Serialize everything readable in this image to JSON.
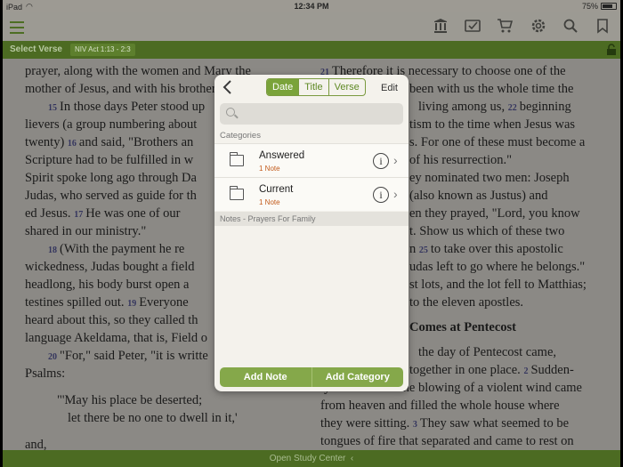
{
  "status_bar": {
    "device": "iPad",
    "time": "12:34 PM",
    "battery": "75%"
  },
  "toolbar": {
    "icons": [
      "menu-icon",
      "library-icon",
      "notes-icon",
      "cart-icon",
      "settings-icon",
      "search-icon",
      "bookmark-icon"
    ]
  },
  "verse_bar": {
    "select_label": "Select Verse",
    "reference": "NIV Act 1:13 - 2:3"
  },
  "scripture": {
    "left_lines": [
      {
        "pre": "prayer,",
        "rest": " along with the women and Mary the"
      },
      {
        "pre": "",
        "rest": "mother of Jesus, and with his brothers."
      },
      {
        "verse": "15",
        "rest": "In those days Peter stood up",
        "indent": true
      },
      {
        "pre": "",
        "rest": "lievers (a group numbering about"
      },
      {
        "pre": "",
        "rest": "twenty)"
      },
      {
        "pre": "",
        "rest": "Scripture had to be fulfilled in w"
      },
      {
        "pre": "",
        "rest": "Spirit spoke long ago through Da"
      },
      {
        "pre": "",
        "rest": "Judas, who served as guide for th"
      },
      {
        "pre": "",
        "rest": "ed Jesus."
      },
      {
        "pre": "",
        "rest": "shared in our ministry.\""
      },
      {
        "verse": "18",
        "rest": "(With the payment he re",
        "indent": true
      },
      {
        "pre": "",
        "rest": "wickedness, Judas bought a field"
      },
      {
        "pre": "",
        "rest": "headlong, his body burst open a"
      },
      {
        "pre": "",
        "rest": "testines spilled out."
      },
      {
        "pre": "",
        "rest": "heard about this, so they called th"
      },
      {
        "pre": "",
        "rest": "language Akeldama, that is, Field o"
      },
      {
        "verse": "20",
        "rest": "\"For,\" said Peter, \"it is writte",
        "indent": true
      },
      {
        "pre": "",
        "rest": "Psalms:"
      }
    ],
    "left_inline_verses": {
      "16": "and said, \"Brothers an",
      "17": "He was one of our",
      "19": "Everyone"
    },
    "quote_lines": [
      "\"'May his place be deserted;",
      "let there be no one to dwell in it,'"
    ],
    "left_last": "and,",
    "right_lines": [
      {
        "verse": "21",
        "rest": "Therefore it is necessary to choose one of the"
      },
      {
        "pre": "",
        "rest": "been with us the whole time the"
      },
      {
        "pre": "",
        "rest": "living among us,"
      },
      {
        "pre": "",
        "rest": "tism to the time when Jesus was"
      },
      {
        "pre": "",
        "rest": "s. For one of these must become a"
      },
      {
        "pre": "",
        "rest": "of his resurrection.\""
      },
      {
        "pre": "",
        "rest": "ey nominated two men: Joseph"
      },
      {
        "pre": "",
        "rest": "(also known as Justus) and"
      },
      {
        "pre": "",
        "rest": "en they prayed, \"Lord, you know"
      },
      {
        "pre": "",
        "rest": "t. Show us which of these two"
      },
      {
        "pre": "",
        "rest": "n"
      },
      {
        "pre": "",
        "rest": "udas left to go where he belongs.\""
      },
      {
        "pre": "",
        "rest": "st lots, and the lot fell to Matthias;"
      },
      {
        "pre": "",
        "rest": "to the eleven apostles."
      }
    ],
    "right_inline_verses": {
      "22": "beginning",
      "25": "to take over this apostolic"
    },
    "right_heading": "Comes at Pentecost",
    "right_tail": [
      {
        "pre": "",
        "rest": "the day of Pentecost came,"
      },
      {
        "pre": "",
        "rest": "together in one place."
      },
      {
        "pre": "",
        "rest": "ly a sound like the blowing of a violent wind came"
      },
      {
        "pre": "",
        "rest": "from heaven and filled the whole house where"
      },
      {
        "pre": "",
        "rest": "they were sitting."
      },
      {
        "pre": "",
        "rest": "tongues of fire that separated and came to rest on"
      }
    ],
    "right_tail_verses": {
      "2": "Sudden-",
      "3": "They saw what seemed to be"
    }
  },
  "bottom_bar": {
    "label": "Open Study Center"
  },
  "modal": {
    "segments": [
      "Date",
      "Title",
      "Verse"
    ],
    "selected_segment": "Date",
    "edit_label": "Edit",
    "search_placeholder": "",
    "categories_label": "Categories",
    "categories": [
      {
        "name": "Answered",
        "count": "1 Note"
      },
      {
        "name": "Current",
        "count": "1 Note"
      }
    ],
    "notes_label": "Notes - Prayers For Family",
    "footer": {
      "add_note": "Add Note",
      "add_category": "Add Category"
    }
  },
  "colors": {
    "green_dark": "#4c6b22",
    "green_accent": "#7aa33a",
    "count_orange": "#c25a1b"
  }
}
